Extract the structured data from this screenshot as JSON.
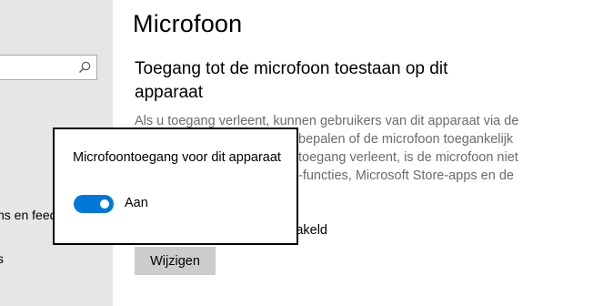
{
  "sidebar": {
    "search": {
      "value": "",
      "icon": "search-icon"
    },
    "items": [
      {
        "label": "ns en feedback"
      },
      {
        "label": "s"
      }
    ]
  },
  "main": {
    "title": "Microfoon",
    "section_heading": "Toegang tot de microfoon toestaan op dit apparaat",
    "description": "Als u toegang verleent, kunnen gebruikers van dit apparaat via de bepalen of de microfoon toegankelijk toegang verleent, is de microfoon niet -functies, Microsoft Store-apps en de",
    "status_text": "voor dit apparaat is ingeschakeld",
    "change_button_label": "Wijzigen"
  },
  "flyout": {
    "label": "Microfoontoegang voor dit apparaat",
    "toggle_state_label": "Aan",
    "toggle_on": true
  },
  "colors": {
    "accent": "#0078d7",
    "sidebar_bg": "#e6e6e6",
    "description_text": "#6b6b6b",
    "button_bg": "#cccccc"
  }
}
